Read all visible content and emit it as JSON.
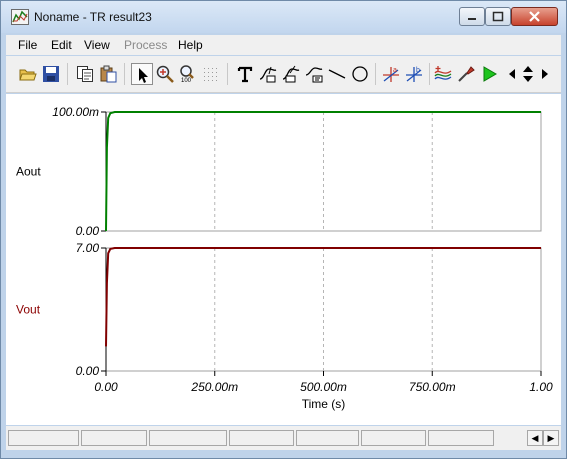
{
  "window": {
    "title": "Noname - TR result23",
    "icon": "chart-app-icon",
    "controls": [
      "minimize-icon",
      "maximize-icon",
      "close-icon"
    ]
  },
  "menu": [
    {
      "label": "File",
      "enabled": true
    },
    {
      "label": "Edit",
      "enabled": true
    },
    {
      "label": "View",
      "enabled": true
    },
    {
      "label": "Process",
      "enabled": false
    },
    {
      "label": "Help",
      "enabled": true
    }
  ],
  "toolbar": {
    "tools": [
      "open-icon",
      "save-icon",
      "copy-icon",
      "paste-icon",
      "pointer-icon",
      "zoom-in-icon",
      "zoom-100-icon",
      "grid-icon",
      "text-icon",
      "curve-annotate-icon",
      "curve-measure-icon",
      "curve-label-icon",
      "line-icon",
      "circle-icon",
      "cursor-a-icon",
      "cursor-b-icon",
      "multi-curve-icon",
      "probe-icon",
      "run-icon",
      "nav-left-icon",
      "nav-updown-icon",
      "nav-right-icon"
    ]
  },
  "plot": {
    "x_axis_label": "Time (s)",
    "x_ticks": [
      "0.00",
      "250.00m",
      "500.00m",
      "750.00m",
      "1.00"
    ],
    "panels": [
      {
        "label": "Aout",
        "label_color": "#000000",
        "y_ticks": [
          "100.00m",
          "0.00"
        ],
        "trace_color": "#008000"
      },
      {
        "label": "Vout",
        "label_color": "#8b0000",
        "y_ticks": [
          "7.00",
          "0.00"
        ],
        "trace_color": "#800000"
      }
    ]
  },
  "chart_data": [
    {
      "type": "line",
      "xlabel": "Time (s)",
      "ylabel": "Aout",
      "xlim": [
        0,
        1
      ],
      "ylim": [
        0,
        0.1
      ],
      "grid": true,
      "series": [
        {
          "name": "Aout",
          "x": [
            0,
            0.002,
            0.005,
            0.01,
            0.02,
            0.5,
            1.0
          ],
          "y": [
            0,
            0.07,
            0.095,
            0.099,
            0.1,
            0.1,
            0.1
          ]
        }
      ]
    },
    {
      "type": "line",
      "xlabel": "Time (s)",
      "ylabel": "Vout",
      "xlim": [
        0,
        1
      ],
      "ylim": [
        0,
        7
      ],
      "grid": true,
      "series": [
        {
          "name": "Vout",
          "x": [
            0,
            0.002,
            0.005,
            0.01,
            0.02,
            0.5,
            1.0
          ],
          "y": [
            1.4,
            5.0,
            6.7,
            6.95,
            7.0,
            7.0,
            7.0
          ]
        }
      ]
    }
  ],
  "statusbar": {
    "segments": 7,
    "scroll_buttons": [
      "scroll-left-icon",
      "scroll-right-icon"
    ]
  }
}
